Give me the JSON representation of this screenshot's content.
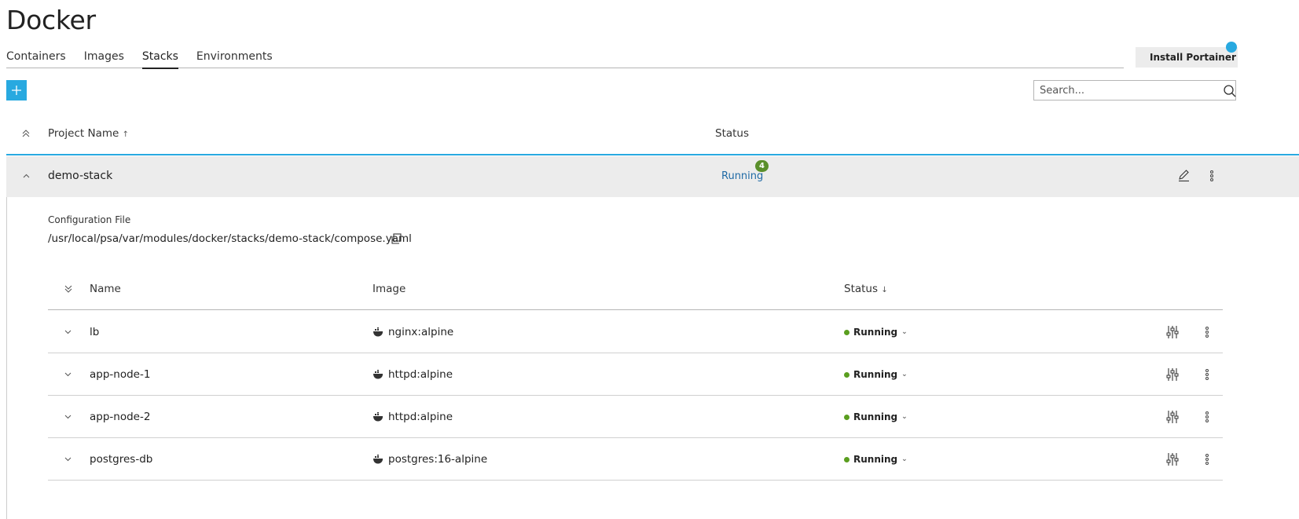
{
  "page": {
    "title": "Docker"
  },
  "tabs": [
    {
      "label": "Containers"
    },
    {
      "label": "Images"
    },
    {
      "label": "Stacks",
      "active": true
    },
    {
      "label": "Environments"
    }
  ],
  "toolbar": {
    "install_label": "Install Portainer",
    "search_placeholder": "Search..."
  },
  "table": {
    "col_project": "Project Name",
    "col_project_sort": "↑",
    "col_status": "Status"
  },
  "stack": {
    "name": "demo-stack",
    "status": "Running",
    "container_count": "4",
    "config_label": "Configuration File",
    "config_path": "/usr/local/psa/var/modules/docker/stacks/demo-stack/compose.yaml"
  },
  "services_table": {
    "col_name": "Name",
    "col_image": "Image",
    "col_status": "Status",
    "col_status_sort": "↓"
  },
  "services": [
    {
      "name": "lb",
      "image": "nginx:alpine",
      "status": "Running"
    },
    {
      "name": "app-node-1",
      "image": "httpd:alpine",
      "status": "Running"
    },
    {
      "name": "app-node-2",
      "image": "httpd:alpine",
      "status": "Running"
    },
    {
      "name": "postgres-db",
      "image": "postgres:16-alpine",
      "status": "Running"
    }
  ],
  "colors": {
    "accent": "#28a9e0",
    "link": "#1f6aa5",
    "running": "#5a9e1f",
    "badge": "#5a8f2b"
  }
}
